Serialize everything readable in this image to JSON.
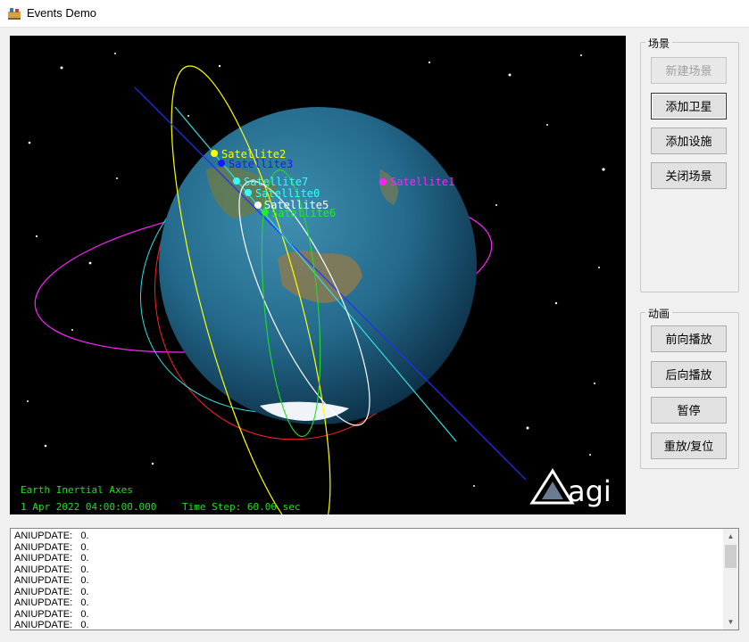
{
  "window": {
    "title": "Events Demo"
  },
  "viewer": {
    "satellites": [
      {
        "label": "Satellite2",
        "color": "#ffff00"
      },
      {
        "label": "Satellite3",
        "color": "#1a1aff"
      },
      {
        "label": "Satellite7",
        "color": "#33ffff"
      },
      {
        "label": "Satellite0",
        "color": "#33ffff"
      },
      {
        "label": "Satellite5",
        "color": "#ffffff"
      },
      {
        "label": "Satellite6",
        "color": "#22ee22"
      },
      {
        "label": "Satellite1",
        "color": "#ff22ff"
      }
    ],
    "axes_label": "Earth Inertial Axes",
    "datetime": "1 Apr 2022 04:00:00.000",
    "time_step": "Time Step: 60.00 sec",
    "logo_text": "agi"
  },
  "scene_group": {
    "label": "场景",
    "buttons": [
      {
        "label": "新建场景",
        "enabled": false
      },
      {
        "label": "添加卫星",
        "enabled": true
      },
      {
        "label": "添加设施",
        "enabled": true
      },
      {
        "label": "关闭场景",
        "enabled": true
      }
    ]
  },
  "animation_group": {
    "label": "动画",
    "buttons": [
      {
        "label": "前向播放"
      },
      {
        "label": "后向播放"
      },
      {
        "label": "暂停"
      },
      {
        "label": "重放/复位"
      }
    ]
  },
  "log": {
    "lines": [
      "ANIUPDATE:   0.",
      "ANIUPDATE:   0.",
      "ANIUPDATE:   0.",
      "ANIUPDATE:   0.",
      "ANIUPDATE:   0.",
      "ANIUPDATE:   0.",
      "ANIUPDATE:   0.",
      "ANIUPDATE:   0.",
      "ANIUPDATE:   0."
    ]
  }
}
